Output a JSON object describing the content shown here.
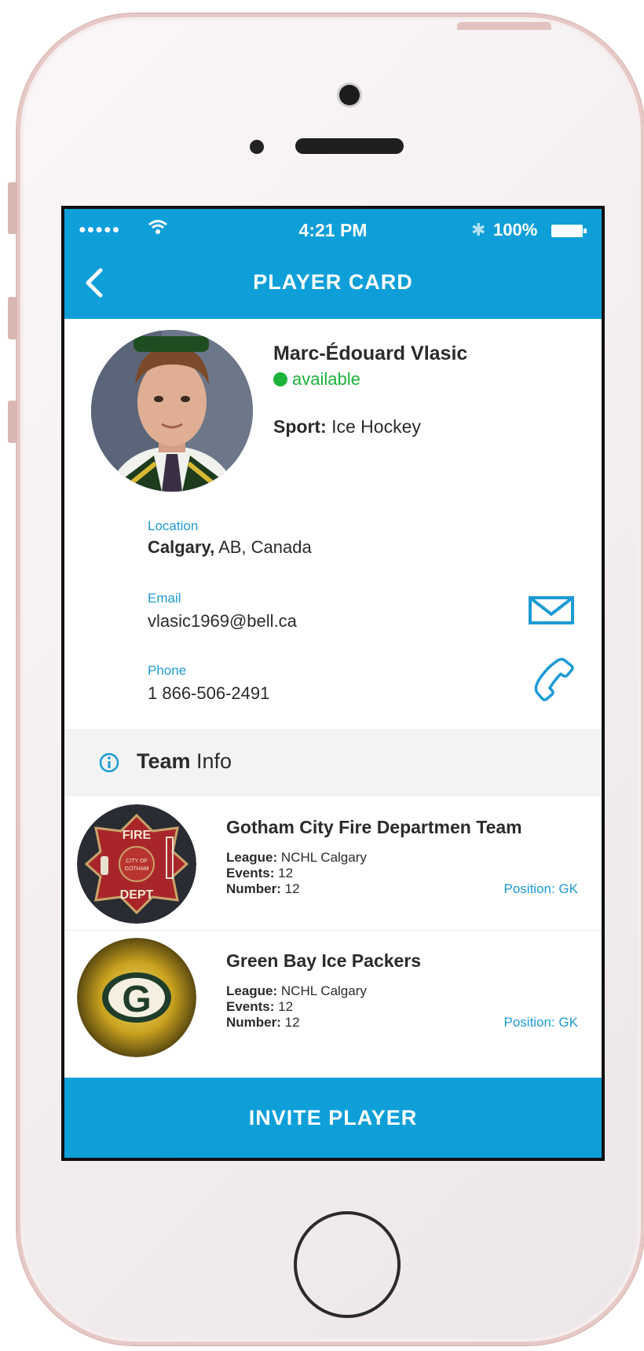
{
  "status_bar": {
    "signal": "●●●●●",
    "time": "4:21 PM",
    "battery": "100%"
  },
  "header": {
    "title": "PLAYER CARD",
    "back_icon": "chevron-left-icon"
  },
  "player": {
    "name": "Marc-Édouard Vlasic",
    "status": "available",
    "sport_label": "Sport:",
    "sport_value": "Ice Hockey"
  },
  "contact": {
    "location_label": "Location",
    "location_city": "Calgary,",
    "location_rest": " AB, Canada",
    "email_label": "Email",
    "email_value": "vlasic1969@bell.ca",
    "phone_label": "Phone",
    "phone_value": "1 866-506-2491"
  },
  "team_info": {
    "bold": "Team",
    "rest": " Info"
  },
  "teams": [
    {
      "name": "Gotham City Fire Departmen Team",
      "league_label": "League:",
      "league": "NCHL Calgary",
      "events_label": "Events:",
      "events": "12",
      "number_label": "Number:",
      "number": "12",
      "position": "Position: GK",
      "logo_text": [
        "FIRE",
        "CITY OF",
        "GOTHAM",
        "DEPT"
      ]
    },
    {
      "name": "Green Bay Ice Packers",
      "league_label": "League:",
      "league": "NCHL Calgary",
      "events_label": "Events:",
      "events": "12",
      "number_label": "Number:",
      "number": "12",
      "position": "Position: GK",
      "logo_text": [
        "G"
      ]
    }
  ],
  "invite_button": "INVITE PLAYER",
  "colors": {
    "accent": "#0e9fd9",
    "available": "#1bb33a"
  }
}
